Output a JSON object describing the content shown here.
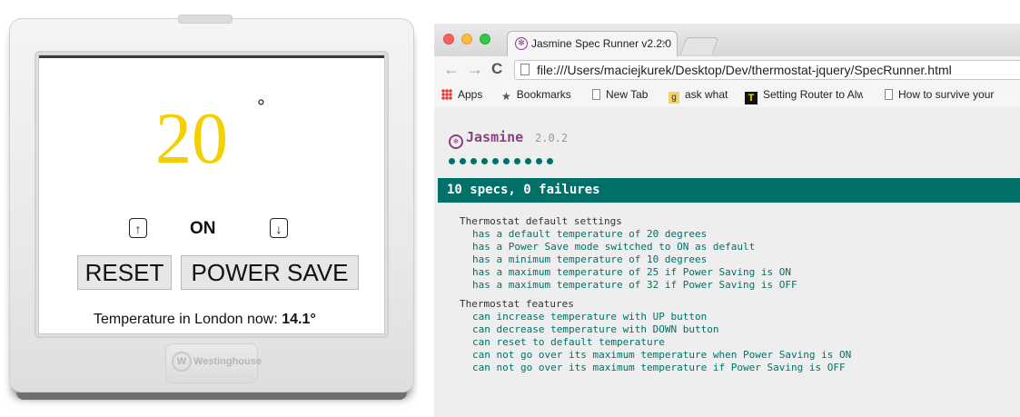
{
  "thermostat": {
    "temperature": "20",
    "degree_symbol": "°",
    "up_label": "↑",
    "down_label": "↓",
    "power_save_status": "ON",
    "reset_label": "RESET",
    "power_save_label": "POWER SAVE",
    "weather_prefix": "Temperature in London now: ",
    "weather_value": "14.1°",
    "brand_logo_text": "Westinghouse",
    "temp_color": "#f5d000"
  },
  "browser": {
    "tab_title": "Jasmine Spec Runner v2.2.0",
    "tab_close": "×",
    "url": "file:///Users/maciejkurek/Desktop/Dev/thermostat-jquery/SpecRunner.html",
    "nav": {
      "back": "←",
      "forward": "→",
      "reload": "C"
    },
    "bookmarks": [
      {
        "label": "Apps",
        "icon": "apps-grid-icon"
      },
      {
        "label": "Bookmarks",
        "icon": "star-icon"
      },
      {
        "label": "New Tab",
        "icon": "page-icon"
      },
      {
        "label": "ask what",
        "icon": "g-icon"
      },
      {
        "label": "Setting Router to Alw",
        "icon": "t-icon"
      },
      {
        "label": "How to survive your",
        "icon": "page-icon"
      }
    ]
  },
  "jasmine": {
    "logo": "Jasmine",
    "version": "2.0.2",
    "summary": "10 specs, 0 failures",
    "accent": "#007069",
    "spec_dot_count": 10,
    "suites": [
      {
        "name": "Thermostat default settings",
        "specs": [
          "has a default temperature of 20 degrees",
          "has a Power Save mode switched to ON as default",
          "has a minimum temperature of 10 degrees",
          "has a maximum temperature of 25 if Power Saving is ON",
          "has a maximum temperature of 32 if Power Saving is OFF"
        ]
      },
      {
        "name": "Thermostat features",
        "specs": [
          "can increase temperature with UP button",
          "can decrease temperature with DOWN button",
          "can reset to default temperature",
          "can not go over its maximum temperature when Power Saving is ON",
          "can not go over its maximum temperature if Power Saving is OFF"
        ]
      }
    ]
  }
}
